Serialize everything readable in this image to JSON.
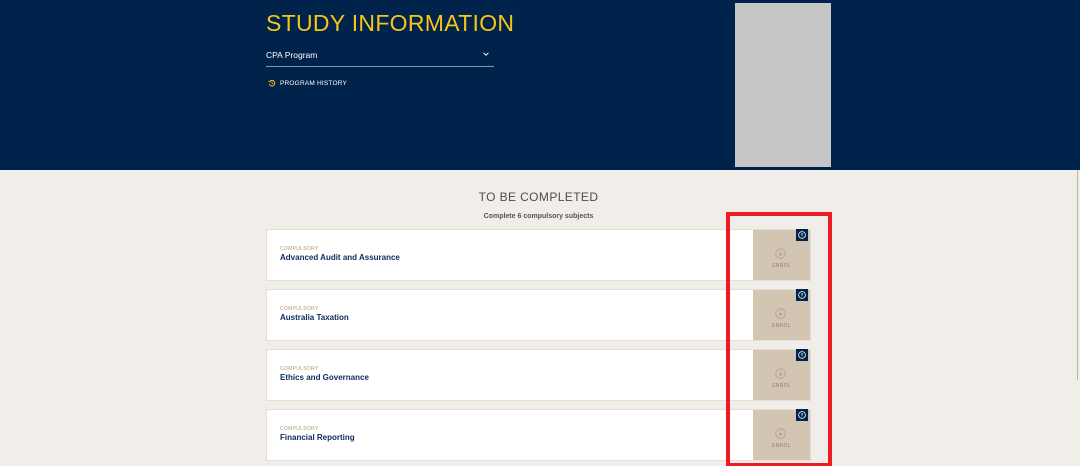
{
  "header": {
    "title": "STUDY INFORMATION",
    "program_select": {
      "value": "CPA Program"
    },
    "history_link": "PROGRAM HISTORY"
  },
  "section": {
    "title": "TO BE COMPLETED",
    "subtitle": "Complete 6 compulsory subjects"
  },
  "subjects": [
    {
      "tag": "COMPULSORY",
      "name": "Advanced Audit and Assurance",
      "action": "ENROL"
    },
    {
      "tag": "COMPULSORY",
      "name": "Australia Taxation",
      "action": "ENROL"
    },
    {
      "tag": "COMPULSORY",
      "name": "Ethics and Governance",
      "action": "ENROL"
    },
    {
      "tag": "COMPULSORY",
      "name": "Financial Reporting",
      "action": "ENROL"
    }
  ],
  "icons": {
    "dropdown": "chevron-down-icon",
    "history": "history-icon",
    "enrol": "download-circle-icon",
    "info": "info-icon"
  },
  "colors": {
    "header_bg": "#00234b",
    "title": "#f5c518",
    "page_bg": "#f1eee9",
    "enrol_bg": "#d2c6b2",
    "highlight": "#ec1c24"
  }
}
